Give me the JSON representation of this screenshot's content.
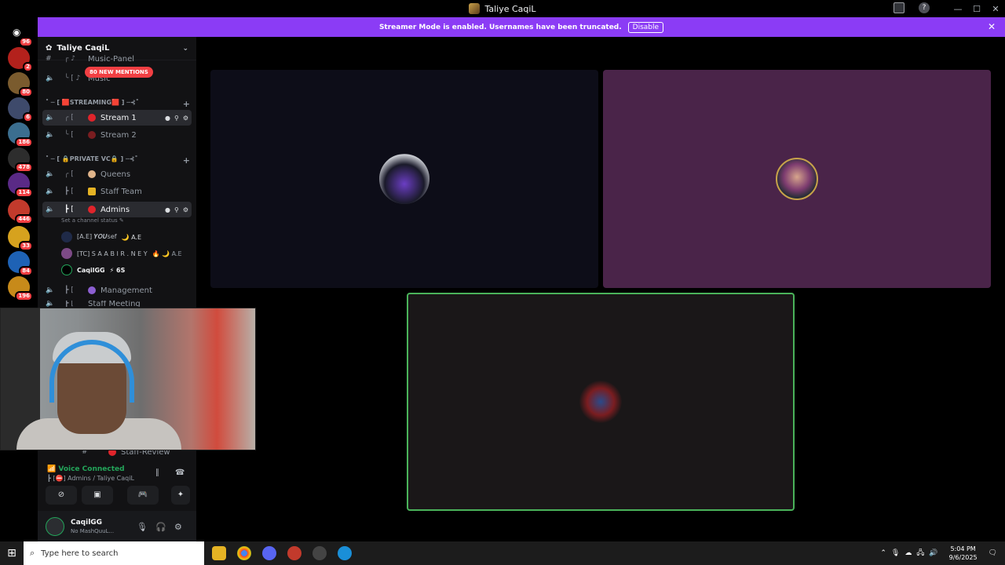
{
  "window": {
    "title": "Taliye CaqiL",
    "minimize": "—",
    "maximize": "☐",
    "close": "✕"
  },
  "banner": {
    "message": "Streamer Mode is enabled. Usernames have been truncated.",
    "button": "Disable",
    "close": "✕"
  },
  "guild_badges": [
    "96",
    "2",
    "80",
    "6",
    "186",
    "478",
    "114",
    "446",
    "33",
    "84",
    "196"
  ],
  "server": {
    "name": "Taliye CaqiL",
    "mentions_pill": "80 NEW MENTIONS",
    "partial_top_channel": "Music-Panel",
    "partial_second_channel": "Music"
  },
  "categories": {
    "streaming": "˚ ─ [ 🟥STREAMING🟥 ] ─⊰˚",
    "private": "˚ ─ [ 🔒PRIVATE VC🔒 ] ─⊰˚"
  },
  "channels": {
    "stream1": "Stream 1",
    "stream2": "Stream 2",
    "queens": "Queens",
    "staff_team": "Staff Team",
    "admins": "Admins",
    "management": "Management",
    "staff_meeting": "Staff Meeting",
    "staff_review": "Staff-Review"
  },
  "admins_status_hint": "Set a channel status ✎",
  "members": [
    {
      "name": "[A.E] 𝒀𝑶𝑼sef",
      "tag": "🌙 A.E"
    },
    {
      "name": "[TC] S A A B I R . N E Y",
      "tag": "🔥 🌙 A.E"
    },
    {
      "name": "CaqilGG",
      "tag": "⚡ 6S"
    }
  ],
  "voice": {
    "status": "Voice Connected",
    "channel": "Admins / Taliye CaqiL"
  },
  "user": {
    "name": "CaqilGG",
    "status": "No MashQuuL..."
  },
  "taskbar": {
    "search_placeholder": "Type here to search",
    "time": "5:04 PM",
    "date": "9/6/2025"
  },
  "colors": {
    "banner": "#8b3cf5",
    "voice_green": "#23a55a",
    "tile_dark": "#0d0d18",
    "tile_purple": "#4a2449",
    "tile_gray": "#1a1718",
    "speaking_border": "#4ab35a"
  }
}
